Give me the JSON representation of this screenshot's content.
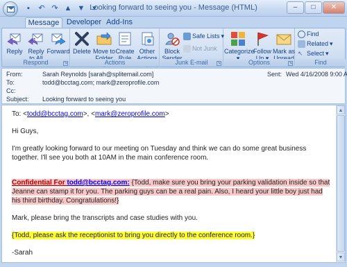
{
  "window": {
    "title": "Looking forward to seeing you - Message (HTML)"
  },
  "tabs": [
    "Message",
    "Developer",
    "Add-Ins"
  ],
  "ribbon": {
    "respond": {
      "label": "Respond",
      "reply": "Reply",
      "reply_all_1": "Reply",
      "reply_all_2": "to All",
      "forward": "Forward"
    },
    "actions": {
      "label": "Actions",
      "delete": "Delete",
      "move_1": "Move to",
      "move_2": "Folder",
      "create_1": "Create",
      "create_2": "Rule",
      "other_1": "Other",
      "other_2": "Actions"
    },
    "junk": {
      "label": "Junk E-mail",
      "block_1": "Block",
      "block_2": "Sender",
      "safe_lists": "Safe Lists",
      "not_junk": "Not Junk"
    },
    "options": {
      "label": "Options",
      "categorize": "Categorize",
      "follow_1": "Follow",
      "follow_2": "Up",
      "mark_1": "Mark as",
      "mark_2": "Unread"
    },
    "find": {
      "label": "Find",
      "find": "Find",
      "related": "Related",
      "select": "Select"
    }
  },
  "headers": {
    "from_label": "From:",
    "from_value": "Sarah Reynolds [sarah@splitemail.com]",
    "to_label": "To:",
    "to_value": "todd@bcctag.com; mark@zeroprofile.com",
    "cc_label": "Cc:",
    "cc_value": "",
    "subject_label": "Subject:",
    "subject_value": "Looking forward to seeing you",
    "sent_label": "Sent:",
    "sent_value": "Wed 4/16/2008 9:00 AM"
  },
  "body": {
    "to_prefix": "To: <",
    "to_email_1": "todd@bcctag.com",
    "to_sep": ">, <",
    "to_email_2": "mark@zeroprofile.com",
    "to_suffix": ">",
    "greeting": "Hi Guys,",
    "paragraph_1": "I'm greatly looking forward to our meeting on Tuesday and think we can do some great business together. I'll see you both at 10AM in the main conference room.",
    "confidential_label": "Confidential For ",
    "confidential_email": "todd@bcctag.com:",
    "confidential_text": " {Todd, make sure you bring your parking validation inside so that Jeanne can stamp it for you. The parking guys can be a real pain. Also, I heard your little boy just had his third birthday. Congratulations!}",
    "paragraph_2": "Mark, please bring the transcripts and case studies with you.",
    "highlight_note": "{Todd, please ask the receptionist to bring you directly to the conference room.}",
    "signature": "-Sarah"
  },
  "colors": {
    "accent": "#15428b",
    "highlight_pink": "#f8c8c8",
    "highlight_yellow": "#ffff33",
    "confidential_red": "#b00000"
  }
}
